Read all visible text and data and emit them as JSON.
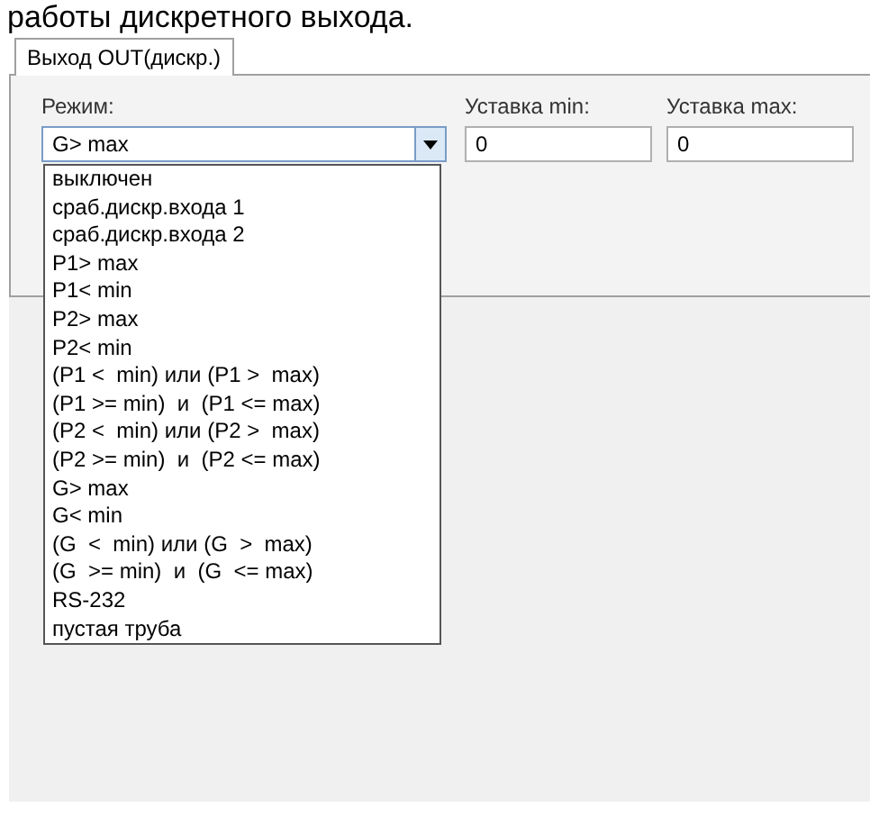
{
  "heading": "работы дискретного выхода.",
  "tabs": [
    {
      "label": "Выход OUT(дискр.)",
      "selected": true
    }
  ],
  "mode": {
    "label": "Режим:",
    "value": "G> max",
    "expanded": true,
    "options": [
      "выключен",
      "сраб.дискр.входа 1",
      "сраб.дискр.входа 2",
      "P1> max",
      "P1< min",
      "P2> max",
      "P2< min",
      "(P1 <  min) или (P1 >  max)",
      "(P1 >= min)  и  (P1 <= max)",
      "(P2 <  min) или (P2 >  max)",
      "(P2 >= min)  и  (P2 <= max)",
      "G> max",
      "G< min",
      "(G  <  min) или (G  >  max)",
      "(G  >= min)  и  (G  <= max)",
      "RS-232",
      "пустая труба"
    ]
  },
  "setpoints": [
    {
      "label": "Уставка min:",
      "value": "0"
    },
    {
      "label": "Уставка max:",
      "value": "0"
    }
  ]
}
